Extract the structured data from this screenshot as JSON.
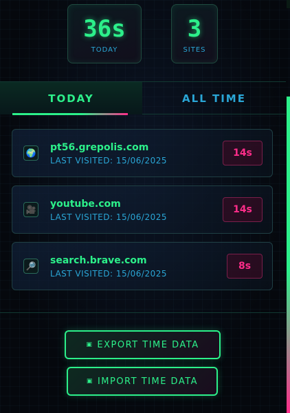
{
  "stats": [
    {
      "value": "36s",
      "label": "TODAY"
    },
    {
      "value": "3",
      "label": "SITES"
    }
  ],
  "tabs": [
    {
      "label": "TODAY",
      "active": true
    },
    {
      "label": "ALL TIME",
      "active": false
    }
  ],
  "sites": [
    {
      "domain": "pt56.grepolis.com",
      "visited": "LAST VISITED: 15/06/2025",
      "time": "14s",
      "icon": "globe-icon",
      "glyph": "🌍"
    },
    {
      "domain": "youtube.com",
      "visited": "LAST VISITED: 15/06/2025",
      "time": "14s",
      "icon": "video-camera-icon",
      "glyph": "🎥"
    },
    {
      "domain": "search.brave.com",
      "visited": "LAST VISITED: 15/06/2025",
      "time": "8s",
      "icon": "magnifier-icon",
      "glyph": "🔎"
    }
  ],
  "actions": {
    "export_label": "EXPORT TIME DATA",
    "import_label": "IMPORT TIME DATA",
    "export_glyph": "▣",
    "import_glyph": "▣"
  },
  "colors": {
    "accent_green": "#2cf08a",
    "accent_blue": "#2aa6d6",
    "accent_pink": "#ff2d8a"
  }
}
